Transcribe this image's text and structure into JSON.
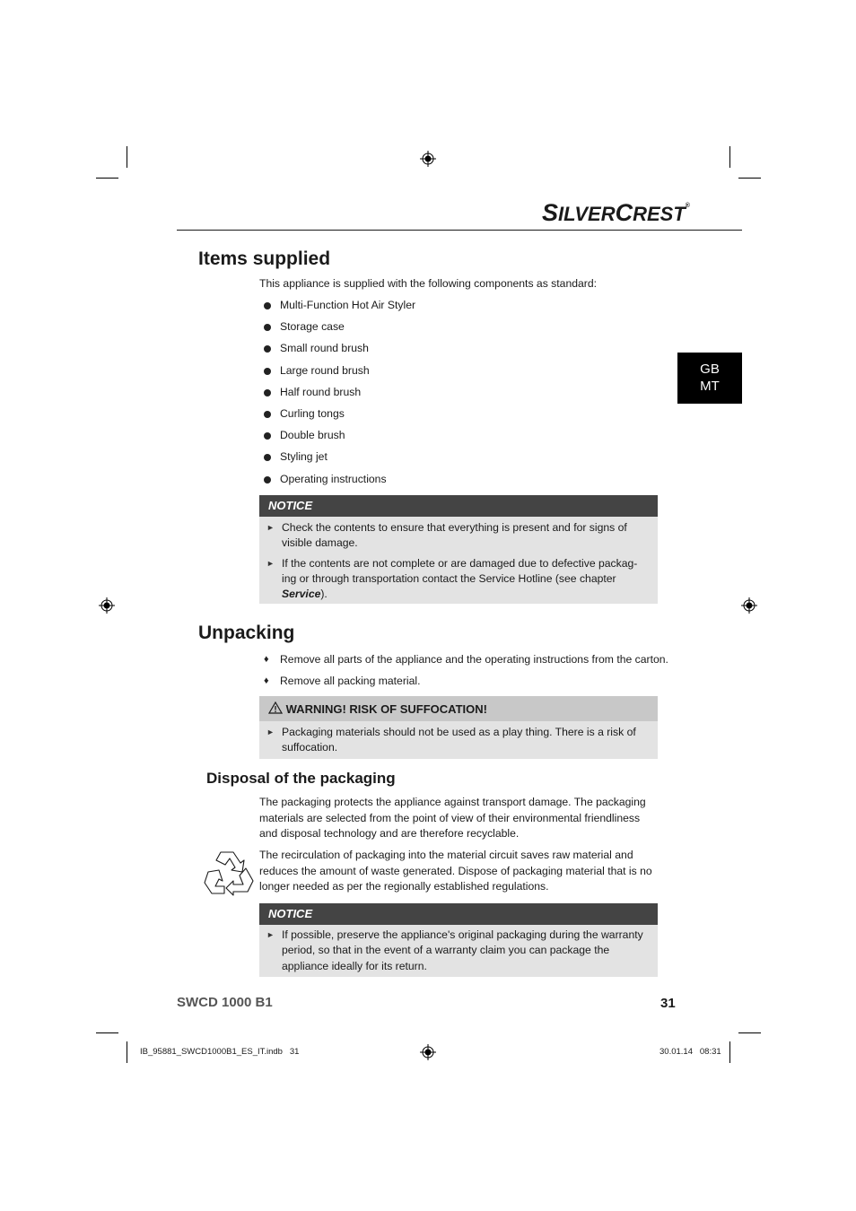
{
  "header": {
    "brand_first": "S",
    "brand_rest1": "ILVER",
    "brand_first2": "C",
    "brand_rest2": "REST",
    "brand_mark": "®"
  },
  "language_tab": {
    "line1": "GB",
    "line2": "MT"
  },
  "items_supplied": {
    "title": "Items supplied",
    "intro": "This appliance is supplied with the following components as standard:",
    "items": [
      "Multi-Function Hot Air Styler",
      "Storage case",
      "Small round brush",
      "Large round brush",
      "Half round brush",
      "Curling tongs",
      "Double brush",
      "Styling jet",
      "Operating instructions"
    ],
    "notice": {
      "title": "NOTICE",
      "items": [
        {
          "text": "Check the contents to ensure that everything is present and for signs of visible damage."
        },
        {
          "text": "If the contents are not complete or are damaged due to defective packag-ing or through transportation contact the Service Hotline (see chapter ",
          "bold": "Service",
          "tail": ")."
        }
      ]
    }
  },
  "unpacking": {
    "title": "Unpacking",
    "steps": [
      "Remove all parts of the appliance and the operating instructions from the carton.",
      "Remove all packing material."
    ],
    "warning": {
      "title": "WARNING! RISK OF SUFFOCATION!",
      "items": [
        "Packaging materials should not be used as a play thing. There is a risk of suffocation."
      ]
    }
  },
  "disposal": {
    "title": "Disposal of the packaging",
    "para1": "The packaging protects the appliance against transport damage. The packaging materials are selected from the point of view of their environmental friendliness and disposal technology and are therefore recyclable.",
    "para2": "The recirculation of packaging into the material circuit saves raw material and reduces the amount of waste generated. Dispose of packaging material that is no longer needed as per the regionally established regulations.",
    "notice": {
      "title": "NOTICE",
      "items": [
        "If possible, preserve the appliance's original packaging during the warranty period, so that in the event of a warranty claim you can package the appliance ideally for its return."
      ]
    }
  },
  "footer": {
    "model": "SWCD 1000 B1",
    "page_number": "31",
    "slug_file": "IB_95881_SWCD1000B1_ES_IT.indb   31",
    "slug_date": "30.01.14   08:31"
  }
}
